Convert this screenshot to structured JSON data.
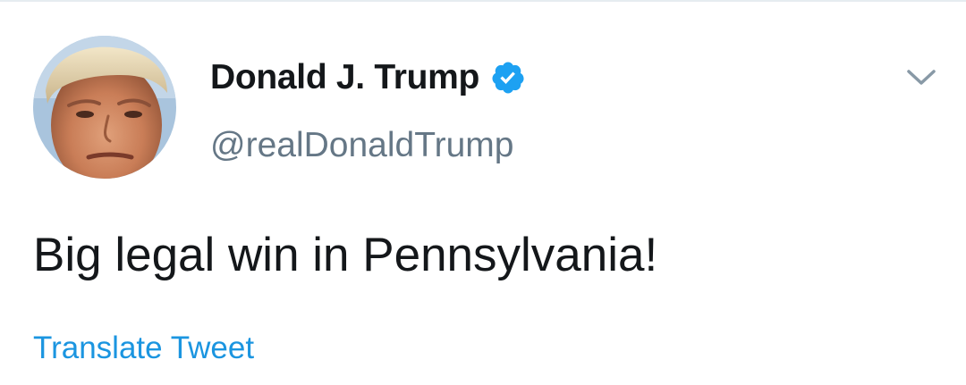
{
  "author": {
    "display_name": "Donald J. Trump",
    "handle": "@realDonaldTrump",
    "verified": true,
    "avatar_icon": "profile-photo-avatar",
    "verified_icon": "verified-badge-icon"
  },
  "tweet": {
    "text": "Big legal win in Pennsylvania!",
    "translate_label": "Translate Tweet"
  },
  "menu": {
    "icon": "chevron-down-icon"
  },
  "colors": {
    "text_primary": "#14171a",
    "text_secondary": "#657786",
    "link_blue": "#1b95e0",
    "verified_blue": "#1da1f2",
    "divider": "#e6ecf0"
  }
}
